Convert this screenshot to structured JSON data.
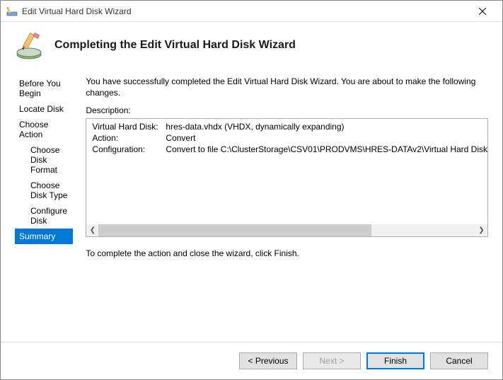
{
  "window": {
    "title": "Edit Virtual Hard Disk Wizard"
  },
  "header": {
    "title": "Completing the Edit Virtual Hard Disk Wizard"
  },
  "sidebar": {
    "steps": [
      {
        "label": "Before You Begin",
        "sub": false,
        "selected": false
      },
      {
        "label": "Locate Disk",
        "sub": false,
        "selected": false
      },
      {
        "label": "Choose Action",
        "sub": false,
        "selected": false
      },
      {
        "label": "Choose Disk Format",
        "sub": true,
        "selected": false
      },
      {
        "label": "Choose Disk Type",
        "sub": true,
        "selected": false
      },
      {
        "label": "Configure Disk",
        "sub": true,
        "selected": false
      },
      {
        "label": "Summary",
        "sub": false,
        "selected": true
      }
    ]
  },
  "content": {
    "intro": "You have successfully completed the Edit Virtual Hard Disk Wizard. You are about to make the following changes.",
    "description_label": "Description:",
    "rows": [
      {
        "key": "Virtual Hard Disk:",
        "val": "hres-data.vhdx (VHDX, dynamically expanding)"
      },
      {
        "key": "Action:",
        "val": "Convert"
      },
      {
        "key": "Configuration:",
        "val": "Convert to file C:\\ClusterStorage\\CSV01\\PRODVMS\\HRES-DATAv2\\Virtual Hard Disk"
      }
    ],
    "complete_note": "To complete the action and close the wizard, click Finish."
  },
  "footer": {
    "previous": "< Previous",
    "next": "Next >",
    "finish": "Finish",
    "cancel": "Cancel"
  }
}
